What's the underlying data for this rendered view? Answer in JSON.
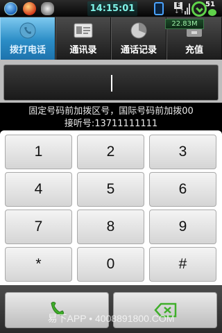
{
  "status_bar": {
    "time": "14:15:01",
    "network_label": "E",
    "network_arrows": "↓↑",
    "battery_level": "51"
  },
  "tabs": [
    {
      "label": "拨打电话",
      "icon": "phone-dial-icon",
      "active": true
    },
    {
      "label": "通讯录",
      "icon": "contacts-card-icon",
      "active": false
    },
    {
      "label": "通话记录",
      "icon": "call-log-pie-icon",
      "active": false
    },
    {
      "label": "充值",
      "icon": "recharge-icon",
      "active": false
    }
  ],
  "memory_badge": "22.83M",
  "dial": {
    "number": ""
  },
  "hint": {
    "line1": "固定号码前加拨区号，国际号码前加拨00",
    "line2": "接听号:13711111111"
  },
  "keypad": {
    "keys": [
      "1",
      "2",
      "3",
      "4",
      "5",
      "6",
      "7",
      "8",
      "9",
      "*",
      "0",
      "#"
    ]
  },
  "bottom": {
    "call_icon": "phone-call-icon",
    "delete_icon": "backspace-icon"
  },
  "watermark": "易下APP • 4008891800.COM",
  "colors": {
    "tab_active": "#2b8dc6",
    "call_icon": "#3fae2a",
    "delete_icon": "#3fae2a",
    "time_text": "#7ff3e8"
  }
}
